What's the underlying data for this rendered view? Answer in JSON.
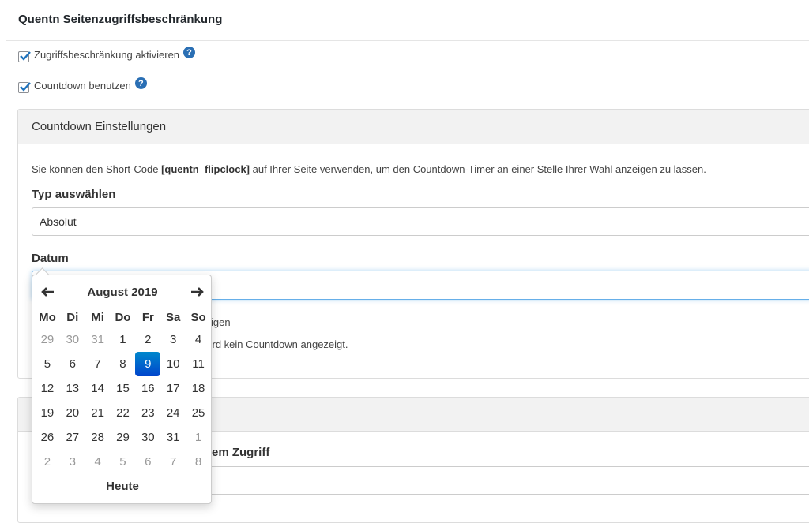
{
  "page": {
    "title": "Quentn Seitenzugriffsbeschränkung",
    "enable_label": "Zugriffsbeschränkung aktivieren",
    "countdown_label": "Countdown benutzen"
  },
  "panel": {
    "title": "Countdown Einstellungen",
    "info_pre": "Sie können den Short-Code ",
    "info_code": "[quentn_flipclock]",
    "info_post": " auf Ihrer Seite verwenden, um den Countdown-Timer an einer Stelle Ihrer Wahl anzeigen zu lassen.",
    "type_label": "Typ auswählen",
    "type_value": "Absolut",
    "date_label": "Datum",
    "date_value": "",
    "hidden_checkbox_partial": "igen",
    "hidden_hint_partial": "/ird kein Countdown angezeigt.",
    "panel2_partial_label": "em Zugriff"
  },
  "datepicker": {
    "month_year": "August 2019",
    "weekdays": [
      "Mo",
      "Di",
      "Mi",
      "Do",
      "Fr",
      "Sa",
      "So"
    ],
    "weeks": [
      [
        {
          "d": "29",
          "old": true
        },
        {
          "d": "30",
          "old": true
        },
        {
          "d": "31",
          "old": true
        },
        {
          "d": "1"
        },
        {
          "d": "2"
        },
        {
          "d": "3"
        },
        {
          "d": "4"
        }
      ],
      [
        {
          "d": "5"
        },
        {
          "d": "6"
        },
        {
          "d": "7"
        },
        {
          "d": "8"
        },
        {
          "d": "9",
          "active": true
        },
        {
          "d": "10"
        },
        {
          "d": "11"
        }
      ],
      [
        {
          "d": "12"
        },
        {
          "d": "13"
        },
        {
          "d": "14"
        },
        {
          "d": "15"
        },
        {
          "d": "16"
        },
        {
          "d": "17"
        },
        {
          "d": "18"
        }
      ],
      [
        {
          "d": "19"
        },
        {
          "d": "20"
        },
        {
          "d": "21"
        },
        {
          "d": "22"
        },
        {
          "d": "23"
        },
        {
          "d": "24"
        },
        {
          "d": "25"
        }
      ],
      [
        {
          "d": "26"
        },
        {
          "d": "27"
        },
        {
          "d": "28"
        },
        {
          "d": "29"
        },
        {
          "d": "30"
        },
        {
          "d": "31"
        },
        {
          "d": "1",
          "old": true
        }
      ],
      [
        {
          "d": "2",
          "old": true
        },
        {
          "d": "3",
          "old": true
        },
        {
          "d": "4",
          "old": true
        },
        {
          "d": "5",
          "old": true
        },
        {
          "d": "6",
          "old": true
        },
        {
          "d": "7",
          "old": true
        },
        {
          "d": "8",
          "old": true
        }
      ]
    ],
    "today_label": "Heute"
  },
  "colors": {
    "accent": "#2a6fb4",
    "active_day": "#0066cc"
  },
  "icons": {
    "help": "question-circle-icon",
    "prev": "arrow-left-icon",
    "next": "arrow-right-icon",
    "check": "checkmark-icon"
  }
}
